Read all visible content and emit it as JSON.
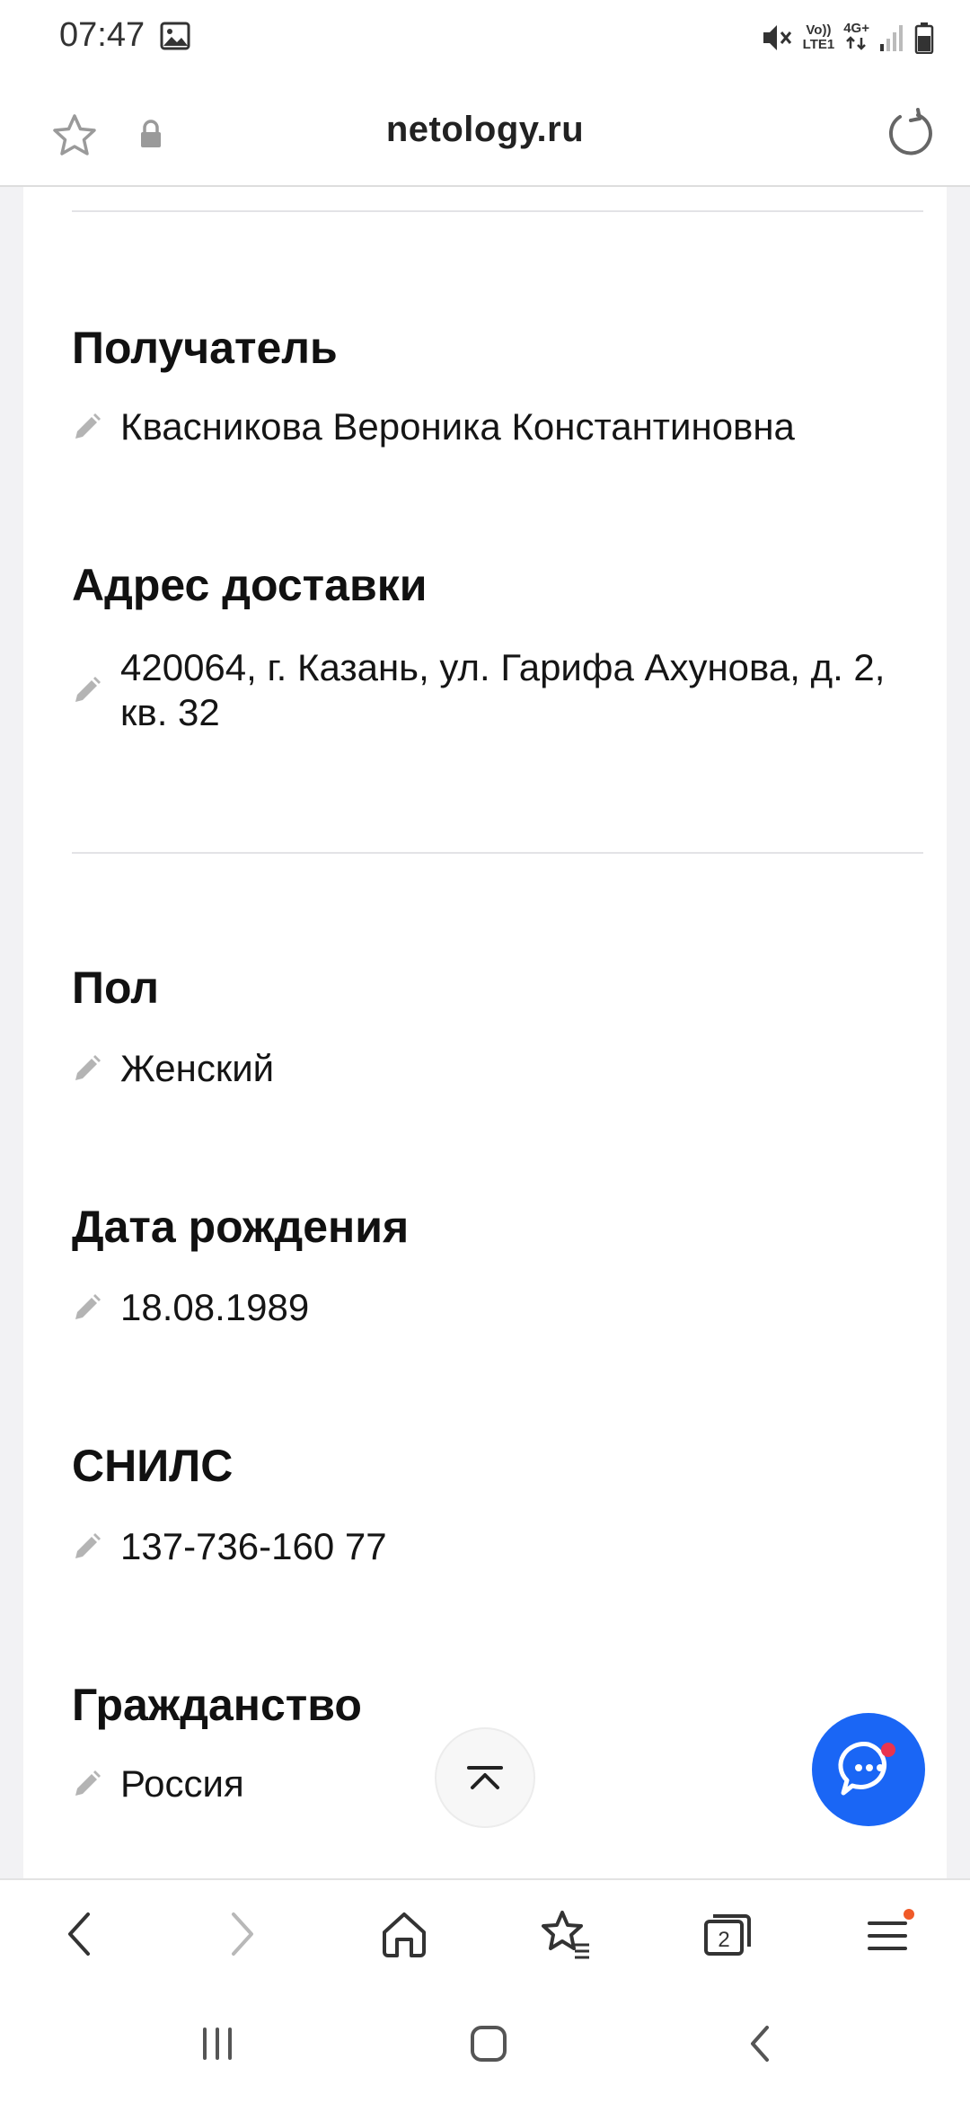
{
  "status_bar": {
    "time": "07:47",
    "volte_line1": "Vo))",
    "volte_line2": "LTE1",
    "network": "4G+"
  },
  "browser": {
    "url": "netology.ru"
  },
  "profile": {
    "recipient_heading": "Получатель",
    "recipient_value": "Квасникова Вероника Константиновна",
    "address_heading": "Адрес доставки",
    "address_value": "420064, г. Казань, ул. Гарифа Ахунова, д. 2, кв. 32",
    "gender_heading": "Пол",
    "gender_value": "Женский",
    "birthdate_heading": "Дата рождения",
    "birthdate_value": "18.08.1989",
    "snils_heading": "СНИЛС",
    "snils_value": "137-736-160 77",
    "citizenship_heading": "Гражданство",
    "citizenship_value": "Россия"
  },
  "toolbar": {
    "tabs_count": "2"
  },
  "colors": {
    "chat_button": "#1a66f5",
    "notification_dot": "#f05a28",
    "chat_badge": "#e8344e"
  }
}
